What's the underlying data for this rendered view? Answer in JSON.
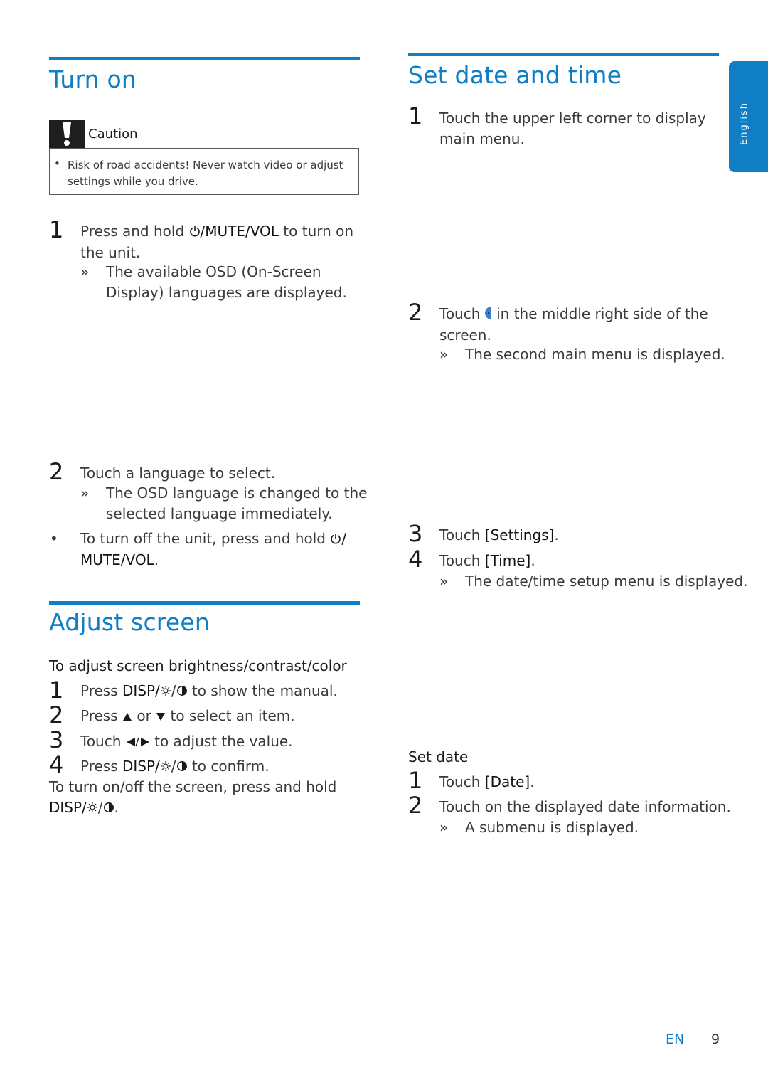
{
  "side_tab": {
    "label": "English"
  },
  "footer": {
    "lang": "EN",
    "page": "9"
  },
  "turn_on": {
    "title": "Turn on",
    "caution": {
      "label": "Caution",
      "icon": "exclamation-icon",
      "text": "Risk of road accidents! Never watch video or adjust settings while you drive."
    },
    "steps": [
      {
        "num": "1",
        "pre": "Press and hold ",
        "icon": "power-icon",
        "key": "/MUTE/VOL",
        "post": " to turn on",
        "line2": "the unit.",
        "result": [
          "The available OSD (On-Screen",
          "Display) languages are displayed."
        ]
      },
      {
        "num": "2",
        "text": "Touch a language to select.",
        "result": [
          "The OSD language is changed to the",
          "selected language immediately."
        ]
      }
    ],
    "note": {
      "pre": "To turn off the unit, press and hold ",
      "icon": "power-icon",
      "key_a": "/",
      "key_b": "MUTE/VOL",
      "post": "."
    },
    "result_mark": "»",
    "bullet": "•"
  },
  "adjust_screen": {
    "title": "Adjust screen",
    "subhead": "To adjust screen brightness/contrast/color",
    "steps": [
      {
        "num": "1",
        "pre": "Press ",
        "key": "DISP/",
        "post": " to show the manual."
      },
      {
        "num": "2",
        "pre": "Press ",
        "mid": " or ",
        "post": " to select an item."
      },
      {
        "num": "3",
        "pre": "Touch ",
        "post": " to adjust the value."
      },
      {
        "num": "4",
        "pre": "Press ",
        "key": "DISP/",
        "post": " to confirm."
      }
    ],
    "note_line1": "To turn on/off the screen, press and hold",
    "note_key": "DISP/",
    "note_post": "."
  },
  "set_date_time": {
    "title": "Set date and time",
    "steps": [
      {
        "num": "1",
        "line1": "Touch the upper left corner to display",
        "line2": "main menu."
      },
      {
        "num": "2",
        "pre": "Touch ",
        "post": " in the middle right side of the",
        "line2": "screen.",
        "result": "The second main menu is displayed."
      },
      {
        "num": "3",
        "pre": "Touch ",
        "key": "[Settings]",
        "post": "."
      },
      {
        "num": "4",
        "pre": "Touch ",
        "key": "[Time]",
        "post": ".",
        "result": "The date/time setup menu is displayed."
      }
    ],
    "set_date": {
      "subhead": "Set date",
      "steps": [
        {
          "num": "1",
          "pre": "Touch ",
          "key": "[Date]",
          "post": "."
        },
        {
          "num": "2",
          "text": "Touch on the displayed date information.",
          "result": "A submenu is displayed."
        }
      ]
    }
  }
}
